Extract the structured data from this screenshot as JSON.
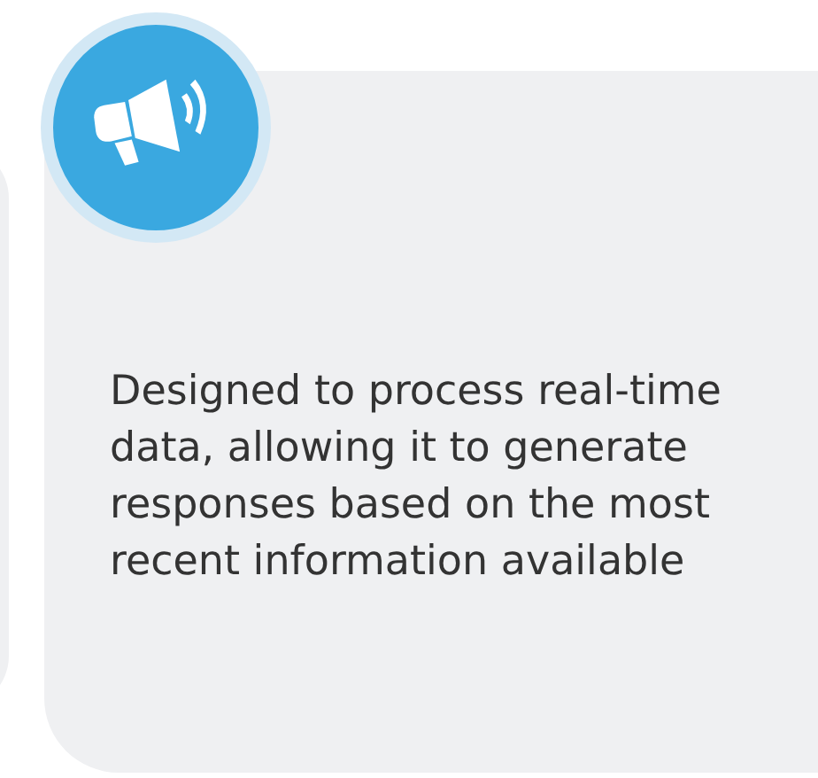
{
  "card": {
    "text": "Designed to process real-time data, allowing it to generate responses based on the most recent information available"
  }
}
